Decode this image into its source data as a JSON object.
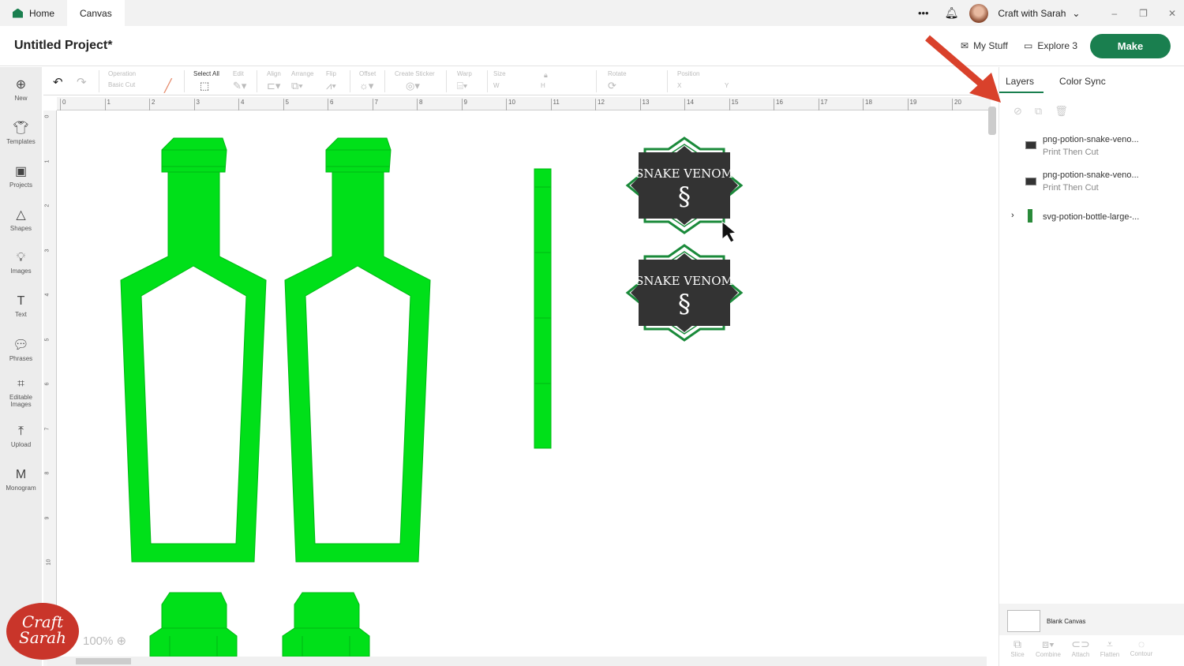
{
  "tabs": [
    {
      "label": "Home"
    },
    {
      "label": "Canvas"
    }
  ],
  "topbar": {
    "more": "•••",
    "account": "Craft with Sarah"
  },
  "header": {
    "title": "Untitled Project*",
    "my_stuff": "My Stuff",
    "machine": "Explore 3",
    "make": "Make"
  },
  "toolbar": {
    "operation": "Operation",
    "operation_value": "Basic Cut",
    "select_all": "Select All",
    "edit": "Edit",
    "align": "Align",
    "arrange": "Arrange",
    "flip": "Flip",
    "offset": "Offset",
    "create_sticker": "Create Sticker",
    "warp": "Warp",
    "size": "Size",
    "w": "W",
    "h": "H",
    "rotate": "Rotate",
    "position": "Position",
    "x": "X",
    "y": "Y"
  },
  "sidebar": [
    {
      "label": "New",
      "icon": "plus-circle"
    },
    {
      "label": "Templates",
      "icon": "shirt"
    },
    {
      "label": "Projects",
      "icon": "projects"
    },
    {
      "label": "Shapes",
      "icon": "shapes"
    },
    {
      "label": "Images",
      "icon": "bulb"
    },
    {
      "label": "Text",
      "icon": "T"
    },
    {
      "label": "Phrases",
      "icon": "speech"
    },
    {
      "label": "Editable Images",
      "icon": "editable"
    },
    {
      "label": "Upload",
      "icon": "upload"
    },
    {
      "label": "Monogram",
      "icon": "monogram"
    }
  ],
  "ruler": {
    "top": [
      "0",
      "1",
      "2",
      "3",
      "4",
      "5",
      "6",
      "7",
      "8",
      "9",
      "10",
      "11",
      "12",
      "13",
      "14",
      "15",
      "16",
      "17",
      "18",
      "19",
      "20"
    ],
    "left": [
      "0",
      "1",
      "2",
      "3",
      "4",
      "5",
      "6",
      "7",
      "8",
      "9",
      "10"
    ]
  },
  "canvas": {
    "label_text": "SNAKE VENOM",
    "shape_color": "#00e019",
    "zoom": "100%"
  },
  "panel": {
    "tabs": [
      "Layers",
      "Color Sync"
    ],
    "layers": [
      {
        "name": "png-potion-snake-veno...",
        "op": "Print Then Cut"
      },
      {
        "name": "png-potion-snake-veno...",
        "op": "Print Then Cut"
      },
      {
        "name": "svg-potion-bottle-large-..."
      }
    ],
    "blank_canvas": "Blank Canvas",
    "actions": [
      "Slice",
      "Combine",
      "Attach",
      "Flatten",
      "Contour"
    ]
  },
  "logo": {
    "text": "Craft with Sarah"
  }
}
